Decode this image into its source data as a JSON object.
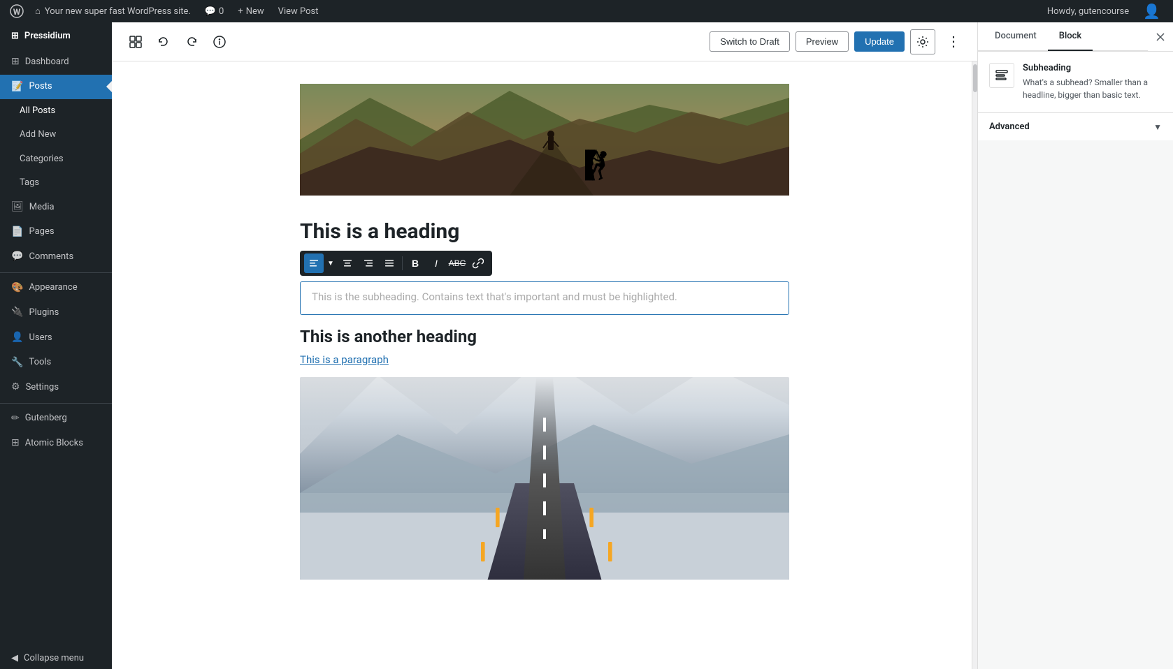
{
  "admin_bar": {
    "site_name": "Your new super fast WordPress site.",
    "comments_count": "0",
    "new_label": "New",
    "view_post_label": "View Post",
    "howdy": "Howdy, gutencourse"
  },
  "sidebar": {
    "brand": "Pressidium",
    "items": [
      {
        "id": "dashboard",
        "label": "Dashboard",
        "icon": "⊞"
      },
      {
        "id": "posts",
        "label": "Posts",
        "icon": "📝",
        "active": true
      },
      {
        "id": "media",
        "label": "Media",
        "icon": "🖼"
      },
      {
        "id": "pages",
        "label": "Pages",
        "icon": "📄"
      },
      {
        "id": "comments",
        "label": "Comments",
        "icon": "💬"
      },
      {
        "id": "appearance",
        "label": "Appearance",
        "icon": "🎨"
      },
      {
        "id": "plugins",
        "label": "Plugins",
        "icon": "🔌"
      },
      {
        "id": "users",
        "label": "Users",
        "icon": "👤"
      },
      {
        "id": "tools",
        "label": "Tools",
        "icon": "🔧"
      },
      {
        "id": "settings",
        "label": "Settings",
        "icon": "⚙"
      },
      {
        "id": "gutenberg",
        "label": "Gutenberg",
        "icon": "✏"
      },
      {
        "id": "atomic-blocks",
        "label": "Atomic Blocks",
        "icon": "⊞"
      }
    ],
    "posts_submenu": [
      {
        "id": "all-posts",
        "label": "All Posts"
      },
      {
        "id": "add-new",
        "label": "Add New"
      },
      {
        "id": "categories",
        "label": "Categories"
      },
      {
        "id": "tags",
        "label": "Tags"
      }
    ],
    "collapse_label": "Collapse menu"
  },
  "toolbar": {
    "switch_draft_label": "Switch to Draft",
    "preview_label": "Preview",
    "update_label": "Update"
  },
  "content": {
    "heading1": "This is a heading",
    "subheading_placeholder": "This is the subheading. Contains text that's important and must be highlighted.",
    "heading2": "This is another heading",
    "paragraph": "This is a paragraph"
  },
  "right_panel": {
    "document_tab": "Document",
    "block_tab": "Block",
    "block_name": "Subheading",
    "block_description": "What's a subhead? Smaller than a headline, bigger than basic text.",
    "advanced_section": "Advanced"
  }
}
